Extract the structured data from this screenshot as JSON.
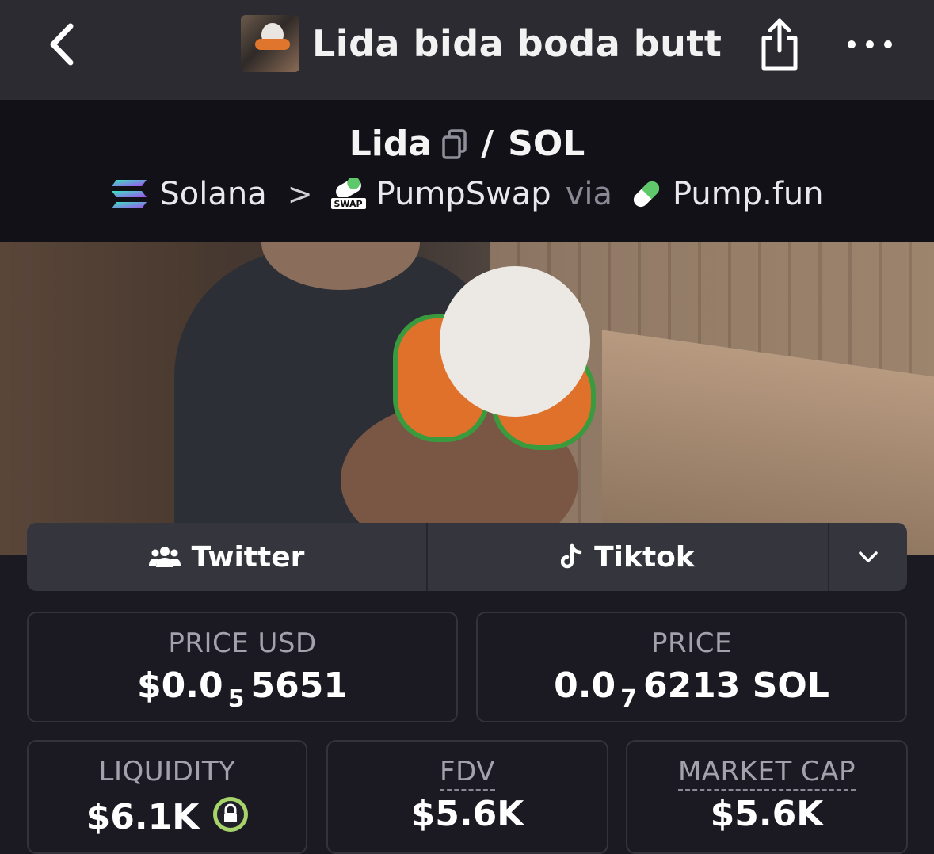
{
  "header": {
    "title": "Lida bida boda butt",
    "back_icon": "chevron-left-icon",
    "share_icon": "share-icon",
    "more_icon": "more-horizontal-icon"
  },
  "pair": {
    "base": "Lida",
    "separator": "/",
    "quote": "SOL",
    "chain": "Solana",
    "dex": "PumpSwap",
    "via": "via",
    "launchpad": "Pump.fun",
    "dex_badge_text": "SWAP"
  },
  "socials": {
    "twitter_label": "Twitter",
    "tiktok_label": "Tiktok"
  },
  "stats": {
    "price_usd": {
      "label": "PRICE USD",
      "prefix": "$0.0",
      "zeros": "5",
      "digits": "5651"
    },
    "price_sol": {
      "label": "PRICE",
      "prefix": "0.0",
      "zeros": "7",
      "digits": "6213 SOL"
    },
    "liquidity": {
      "label": "LIQUIDITY",
      "value": "$6.1K"
    },
    "fdv": {
      "label": "FDV",
      "value": "$5.6K"
    },
    "market_cap": {
      "label": "MARKET CAP",
      "value": "$5.6K"
    }
  },
  "colors": {
    "background": "#1b1a22",
    "header_bg": "#2b2b31",
    "pairbar_bg": "#121117",
    "lock_green": "#a6d46a"
  }
}
